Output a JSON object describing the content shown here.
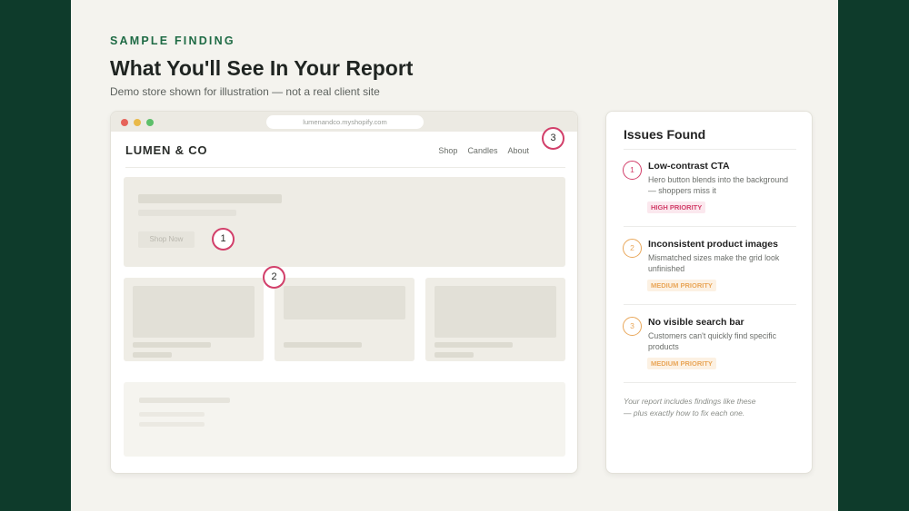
{
  "header": {
    "eyebrow": "SAMPLE FINDING",
    "title": "What You'll See In Your Report",
    "subtitle": "Demo store shown for illustration — not a real client site"
  },
  "browser": {
    "url": "lumenandco.myshopify.com",
    "store_name": "LUMEN & CO",
    "nav": [
      "Shop",
      "Candles",
      "About"
    ],
    "hero_button": "Shop Now",
    "markers": [
      "1",
      "2",
      "3"
    ]
  },
  "panel": {
    "title": "Issues Found",
    "issues": [
      {
        "number": "1",
        "title": "Low-contrast CTA",
        "description": "Hero button blends into the background — shoppers miss it",
        "priority": "HIGH PRIORITY"
      },
      {
        "number": "2",
        "title": "Inconsistent product images",
        "description": "Mismatched sizes make the grid look unfinished",
        "priority": "MEDIUM PRIORITY"
      },
      {
        "number": "3",
        "title": "No visible search bar",
        "description": "Customers can't quickly find specific products",
        "priority": "MEDIUM PRIORITY"
      }
    ],
    "note": "Your report includes findings like these — plus exactly how to fix each one."
  },
  "colors": {
    "background": "#0e3b2b",
    "accent_green": "#1f6b45",
    "high_priority": "#d23f6a",
    "medium_priority": "#e9a75a"
  }
}
